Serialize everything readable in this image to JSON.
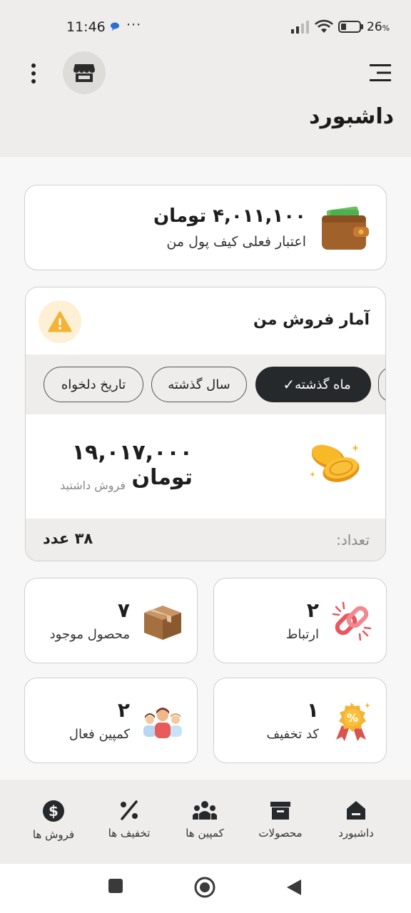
{
  "status_bar": {
    "time": "11:46",
    "dots": "···",
    "battery": "26",
    "battery_unit": "%"
  },
  "header": {
    "title": "داشبورد"
  },
  "wallet": {
    "amount": "۴,۰۱۱,۱۰۰ تومان",
    "label": "اعتبار فعلی کیف پول من"
  },
  "sales": {
    "title": "آمار فروش من",
    "filters": [
      {
        "label": "ماه گذشته",
        "active": true
      },
      {
        "label": "سال گذشته",
        "active": false
      },
      {
        "label": "تاریخ دلخواه",
        "active": false
      }
    ],
    "amount": "۱۹,۰۱۷,۰۰۰ تومان",
    "sub_label": "فروش داشتید",
    "count_label": "تعداد:",
    "count_value": "۳۸ عدد"
  },
  "stats": [
    {
      "number": "۲",
      "label": "ارتباط",
      "icon": "link-icon"
    },
    {
      "number": "۷",
      "label": "محصول موجود",
      "icon": "box-icon"
    },
    {
      "number": "۱",
      "label": "کد تخفیف",
      "icon": "discount-badge-icon"
    },
    {
      "number": "۲",
      "label": "کمپین فعال",
      "icon": "people-icon"
    }
  ],
  "bottom_nav": [
    {
      "label": "داشبورد",
      "icon": "dashboard-icon"
    },
    {
      "label": "محصولات",
      "icon": "archive-icon"
    },
    {
      "label": "کمپین ها",
      "icon": "group-icon"
    },
    {
      "label": "تخفیف ها",
      "icon": "percent-icon"
    },
    {
      "label": "فروش ها",
      "icon": "dollar-icon"
    }
  ],
  "colors": {
    "accent_dark": "#26292c",
    "background": "#efedeb",
    "warning": "#f5b335"
  }
}
